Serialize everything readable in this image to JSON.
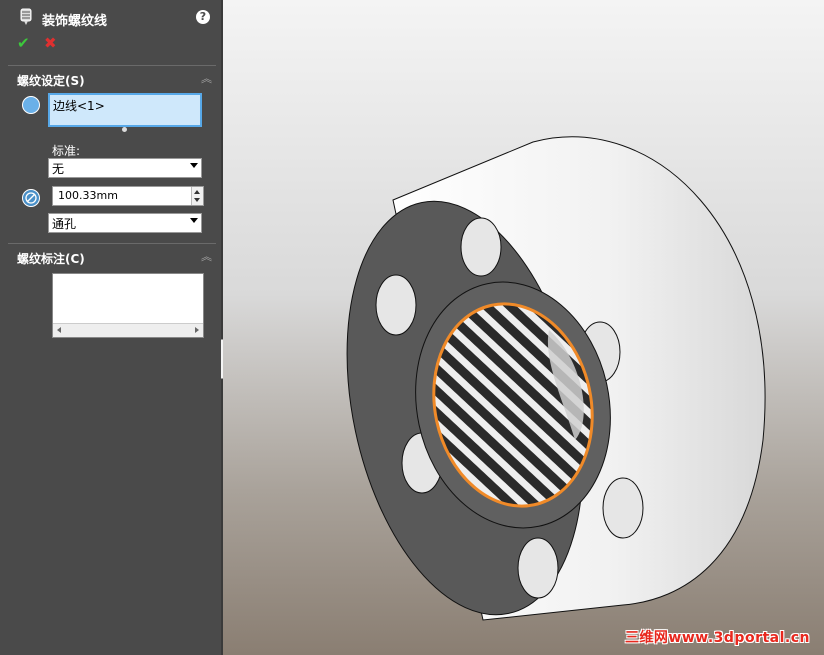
{
  "panel": {
    "title": "装饰螺纹线",
    "help_label": "?",
    "ok_label": "✔",
    "cancel_label": "✖",
    "section_thread_settings": "螺纹设定(S)",
    "edge_selection": "边线<1>",
    "standard_label": "标准:",
    "standard_value": "无",
    "diameter_value": "100.33mm",
    "end_condition_value": "通孔",
    "section_thread_callout": "螺纹标注(C)"
  },
  "viewport": {
    "watermark": "三维网www.3dportal.cn",
    "part_colors": {
      "face": "#595959",
      "cylinder": "#f2f2f2",
      "edge_highlight": "#f08a28"
    }
  },
  "icons": [
    "thread-feature-icon",
    "help-icon",
    "ok-check-icon",
    "cancel-x-icon",
    "edge-select-icon",
    "diameter-icon",
    "collapse-chevron-icon"
  ]
}
